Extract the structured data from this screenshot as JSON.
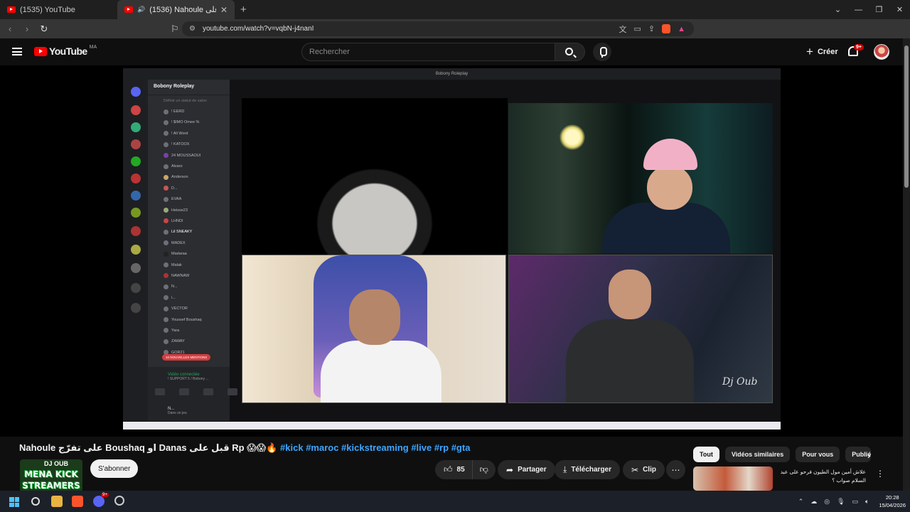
{
  "browser": {
    "tabs": [
      {
        "title": "(1535) YouTube"
      },
      {
        "title": "(1536) Nahoule على تفرّج على Bo"
      }
    ],
    "url": "youtube.com/watch?v=vqbN-j4nanI"
  },
  "header": {
    "logo_text": "YouTube",
    "country": "MA",
    "search_placeholder": "Rechercher",
    "create_label": "Créer",
    "notifications_badge": "9+"
  },
  "player": {
    "app_title": "Bobony Roleplay",
    "server_name": "Bobony Roleplay",
    "status_placeholder": "Définir un statut de salon",
    "members": [
      "! EERD",
      "! $IMO Omee %",
      "! All Word",
      "! KATOOX",
      "24 MOUSSAOUI",
      "Alvaro",
      "Anderson",
      "D...",
      "EVAA",
      "Heisse23",
      "LHNDI",
      "Lil SNEAKY",
      "MADEX",
      "Madaraa",
      "Malak",
      "NAWNAW",
      "N...",
      "i...",
      "VECTOR",
      "Youssef Boushaq",
      "Yara",
      "ZAWAY",
      "GOR21"
    ],
    "new_mentions": "10 NOUVELLES MENTIONS",
    "voice_connected": "Vidéo connectée",
    "voice_sub": "! SUPPORT 5 / Bobony ...",
    "self_user": "N...",
    "self_status": "Dans un jeu",
    "watermark": "Dj Oub"
  },
  "video": {
    "title_main": "Nahoule على تفرّج Boushaq او Danas قبل على Rp 😱😱🔥",
    "title_tags": "#kick #maroc #kickstreaming #live #rp #gta",
    "channel_name": "DJ OUB",
    "avatar_line1": "MENA KICK",
    "avatar_line2": "STREAMERS",
    "subscribe_label": "S'abonner",
    "likes": "85",
    "share_label": "Partager",
    "download_label": "Télécharger",
    "clip_label": "Clip"
  },
  "sidebar": {
    "chips": [
      "Tout",
      "Vidéos similaires",
      "Pour vous",
      "Publié"
    ],
    "rec_title": "علاش أمين مول الطيون فرحو على عبد السلام صواب ؟"
  },
  "taskbar": {
    "time": "20:28",
    "date": "15/04/2026",
    "notif_badge": "9+"
  }
}
